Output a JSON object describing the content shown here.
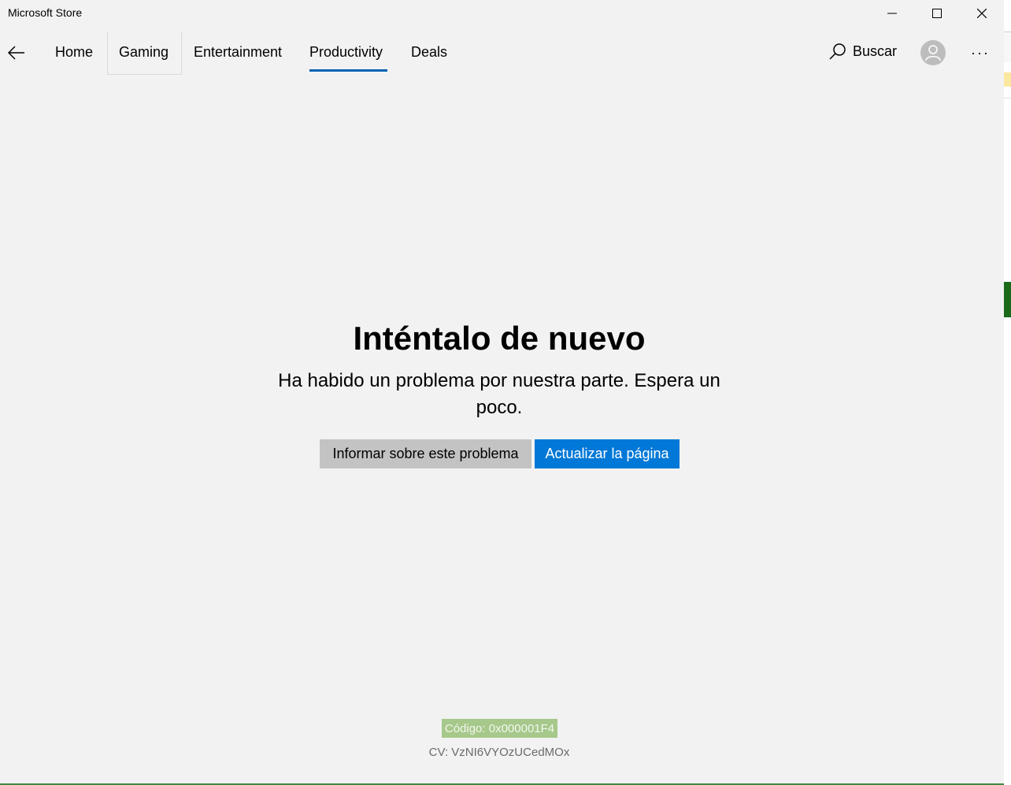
{
  "window": {
    "title": "Microsoft Store"
  },
  "nav": {
    "back_icon": "back-arrow-icon",
    "tabs": [
      {
        "label": "Home",
        "selected": false
      },
      {
        "label": "Gaming",
        "selected": false
      },
      {
        "label": "Entertainment",
        "selected": false
      },
      {
        "label": "Productivity",
        "selected": true
      },
      {
        "label": "Deals",
        "selected": false
      }
    ],
    "search_label": "Buscar",
    "more_label": "···"
  },
  "error": {
    "title": "Inténtalo de nuevo",
    "message": "Ha habido un problema por nuestra parte. Espera un poco.",
    "report_button": "Informar sobre este problema",
    "refresh_button": "Actualizar la página",
    "code": "Código: 0x000001F4",
    "cv": "CV: VzNI6VYOzUCedMOx"
  },
  "colors": {
    "accent": "#0078d7",
    "tab_underline": "#0063b1",
    "background": "#f2f2f2",
    "report_button_bg": "#c3c3c3",
    "code_highlight": "#a6c88a"
  }
}
